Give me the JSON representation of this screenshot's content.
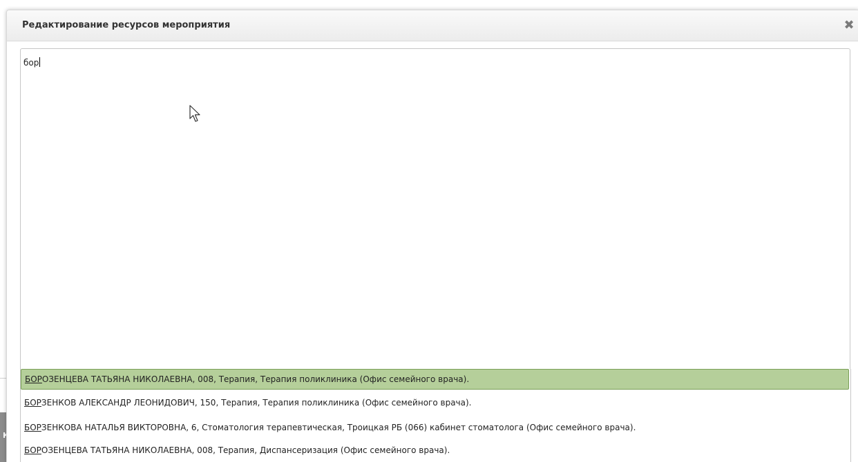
{
  "dialog": {
    "title": "Редактирование ресурсов мероприятия",
    "close_label": "✖"
  },
  "editor": {
    "value": "бор"
  },
  "background": {
    "partial_text": "КИ"
  },
  "suggestions": {
    "items": [
      {
        "match": "БОР",
        "rest": "ОЗЕНЦЕВА ТАТЬЯНА НИКОЛАЕВНА, 008, Терапия, Терапия поликлиника (Офис семейного врача).",
        "active": true
      },
      {
        "match": "БОР",
        "rest": "ЗЕНКОВ АЛЕКСАНДР ЛЕОНИДОВИЧ, 150, Терапия, Терапия поликлиника (Офис семейного врача).",
        "active": false
      },
      {
        "match": "БОР",
        "rest": "ЗЕНКОВА НАТАЛЬЯ ВИКТОРОВНА, 6, Стоматология терапевтическая, Троицкая РБ (066) кабинет стоматолога (Офис семейного врача).",
        "active": false
      },
      {
        "match": "БОР",
        "rest": "ОЗЕНЦЕВА ТАТЬЯНА НИКОЛАЕВНА, 008, Терапия, Диспансеризация (Офис семейного врача).",
        "active": false
      }
    ]
  },
  "colors": {
    "active_bg": "#b5cf9a",
    "active_border": "#7a9f57",
    "header_bg": "#efefef"
  }
}
